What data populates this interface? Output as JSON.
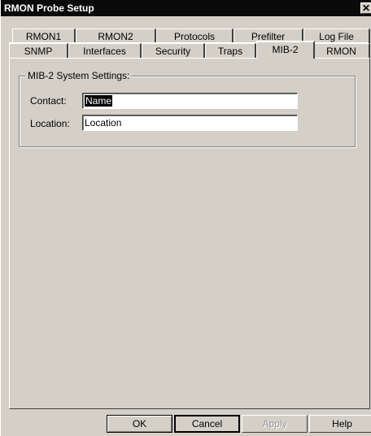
{
  "window": {
    "title": "RMON Probe Setup",
    "close_glyph": "✕"
  },
  "tabs_back": [
    "RMON1",
    "RMON2",
    "Protocols",
    "Prefilter",
    "Log File"
  ],
  "tabs_front": [
    "SNMP",
    "Interfaces",
    "Security",
    "Traps",
    "MIB-2",
    "RMON"
  ],
  "active_tab": "MIB-2",
  "group": {
    "title": "MIB-2 System Settings:",
    "contact_label": "Contact:",
    "contact_value": "Name",
    "location_label": "Location:",
    "location_value": "Location"
  },
  "buttons": {
    "ok": "OK",
    "cancel": "Cancel",
    "apply": "Apply",
    "help": "Help"
  }
}
